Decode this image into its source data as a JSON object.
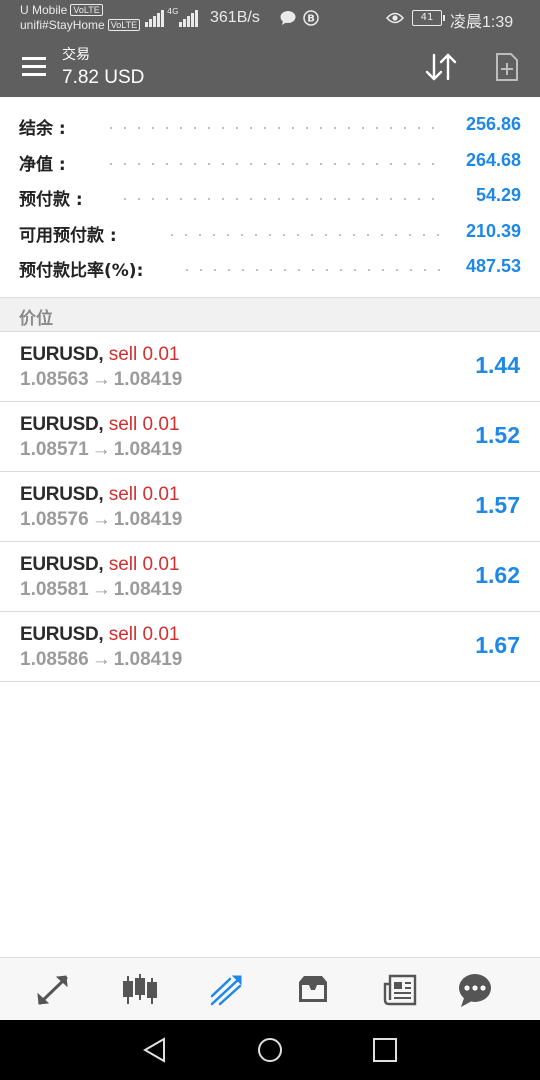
{
  "status_bar": {
    "carrier_line1": "U Mobile",
    "carrier_line2": "unifi#StayHome",
    "volte_badge": "VoLTE",
    "network_type": "4G",
    "net_speed": "361B/s",
    "battery_level": "41",
    "time": "凌晨1:39",
    "icons": [
      "signal-icon",
      "chat-bubble-icon",
      "b-circle-icon",
      "eye-icon",
      "battery-icon"
    ]
  },
  "header": {
    "title": "交易",
    "subtitle": "7.82 USD",
    "icons": [
      "menu-icon",
      "sort-icon",
      "new-order-icon"
    ]
  },
  "summary": [
    {
      "label": "结余 :",
      "value": "256.86"
    },
    {
      "label": "净值 :",
      "value": "264.68"
    },
    {
      "label": "预付款 :",
      "value": "54.29"
    },
    {
      "label": "可用预付款 :",
      "value": "210.39"
    },
    {
      "label": "预付款比率(%):",
      "value": "487.53"
    }
  ],
  "section": {
    "label": "价位"
  },
  "positions": [
    {
      "symbol": "EURUSD,",
      "side": "sell 0.01",
      "open_price": "1.08563",
      "arrow": "→",
      "current_price": "1.08419",
      "profit": "1.44"
    },
    {
      "symbol": "EURUSD,",
      "side": "sell 0.01",
      "open_price": "1.08571",
      "arrow": "→",
      "current_price": "1.08419",
      "profit": "1.52"
    },
    {
      "symbol": "EURUSD,",
      "side": "sell 0.01",
      "open_price": "1.08576",
      "arrow": "→",
      "current_price": "1.08419",
      "profit": "1.57"
    },
    {
      "symbol": "EURUSD,",
      "side": "sell 0.01",
      "open_price": "1.08581",
      "arrow": "→",
      "current_price": "1.08419",
      "profit": "1.62"
    },
    {
      "symbol": "EURUSD,",
      "side": "sell 0.01",
      "open_price": "1.08586",
      "arrow": "→",
      "current_price": "1.08419",
      "profit": "1.67"
    }
  ],
  "bottom_nav": {
    "items": [
      "quotes-icon",
      "chart-icon",
      "trade-icon",
      "history-icon",
      "news-icon",
      "chat-icon"
    ],
    "active": "trade-icon"
  },
  "system_nav": [
    "back-icon",
    "home-icon",
    "recents-icon"
  ],
  "colors": {
    "header_bg": "#5f5f5f",
    "accent_blue": "#1e88e5",
    "sell_red": "#d32f2f",
    "price_gray": "#9b9b9b",
    "nav_icon_gray": "#555555"
  }
}
